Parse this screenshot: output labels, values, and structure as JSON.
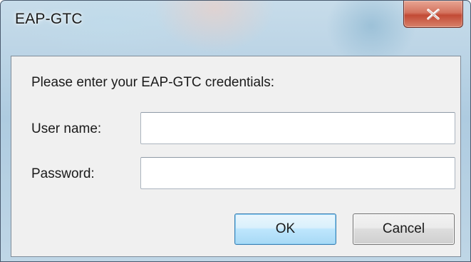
{
  "window": {
    "title": "EAP-GTC",
    "close_icon": "close-x-icon"
  },
  "dialog": {
    "prompt": "Please enter your EAP-GTC credentials:",
    "username_label": "User name:",
    "username_value": "",
    "password_label": "Password:",
    "password_value": ""
  },
  "buttons": {
    "ok_label": "OK",
    "cancel_label": "Cancel"
  },
  "colors": {
    "close_button": "#c24a35",
    "default_button_border": "#3c7fb1",
    "dialog_background": "#f0f0f0"
  }
}
